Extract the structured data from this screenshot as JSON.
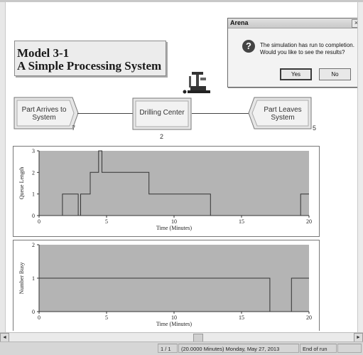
{
  "model_title": {
    "line1": "Model 3-1",
    "line2": "A Simple Processing System"
  },
  "flow": {
    "arrive": {
      "label_line1": "Part Arrives to",
      "label_line2": "System",
      "number": "7"
    },
    "process": {
      "label": "Drilling Center",
      "number": "2"
    },
    "leave": {
      "label_line1": "Part Leaves",
      "label_line2": "System",
      "number": "5"
    }
  },
  "dialog": {
    "title": "Arena",
    "close": "×",
    "icon": "question-icon",
    "message_line1": "The simulation has run to completion.",
    "message_line2": "Would you like to see the results?",
    "yes": "Yes",
    "no": "No"
  },
  "chart_data": [
    {
      "type": "line",
      "style": "step",
      "ylabel": "Queue Length",
      "xlabel": "Time (Minutes)",
      "xlim": [
        0,
        20
      ],
      "ylim": [
        0,
        3
      ],
      "xticks": [
        "0",
        "5",
        "10",
        "15",
        "20"
      ],
      "yticks": [
        "0",
        "1",
        "2",
        "3"
      ],
      "series": [
        {
          "x": [
            0,
            1.73,
            1.73,
            2.9,
            2.9,
            3.08,
            3.08,
            3.79,
            3.79,
            4.41,
            4.41,
            4.66,
            4.66,
            8.14,
            8.14,
            12.7,
            12.7,
            19.38,
            19.38,
            20
          ],
          "y": [
            0,
            0,
            1,
            1,
            0,
            0,
            1,
            1,
            2,
            2,
            3,
            3,
            2,
            2,
            1,
            1,
            0,
            0,
            1,
            1
          ]
        }
      ],
      "fill_color": "#b4b4b4",
      "line_color": "#333333"
    },
    {
      "type": "line",
      "style": "step",
      "ylabel": "Number Busy",
      "xlabel": "Time (Minutes)",
      "xlim": [
        0,
        20
      ],
      "ylim": [
        0,
        2
      ],
      "xticks": [
        "0",
        "5",
        "10",
        "15",
        "20"
      ],
      "yticks": [
        "0",
        "1",
        "2"
      ],
      "series": [
        {
          "x": [
            0,
            0,
            17.1,
            17.1,
            18.7,
            18.7,
            20
          ],
          "y": [
            0,
            1,
            1,
            0,
            0,
            1,
            1
          ]
        }
      ],
      "fill_color": "#b4b4b4",
      "line_color": "#333333"
    }
  ],
  "statusbar": {
    "page": "1 / 1",
    "time": "(20.0000 Minutes) Monday, May 27, 2013",
    "state": "End of run"
  },
  "colors": {
    "chart_fill": "#b4b4b4",
    "background": "#ffffff"
  }
}
